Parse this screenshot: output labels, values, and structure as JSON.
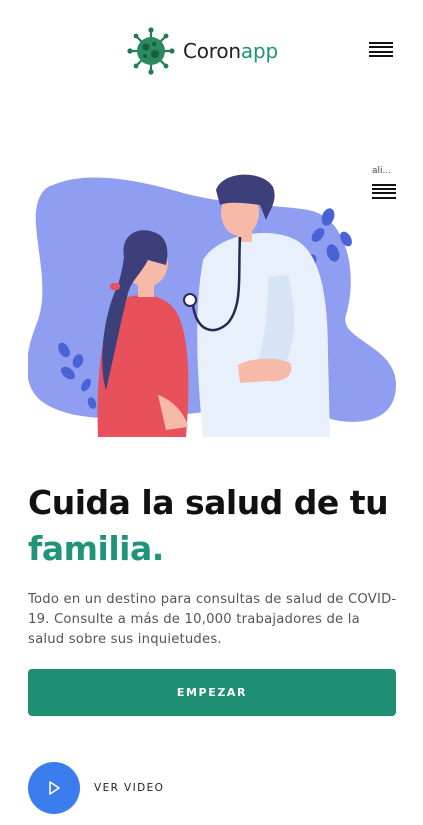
{
  "header": {
    "logo_part1": "Coron",
    "logo_part2": "app",
    "menu_icon": "hamburger-menu-icon",
    "logo_icon": "virus-icon"
  },
  "side_menu": {
    "label": "ali...",
    "icon": "hamburger-menu-icon"
  },
  "hero": {
    "illustration": "doctor-examining-girl-illustration",
    "headline_line1": "Cuida la salud de tu",
    "headline_line2": "familia.",
    "description": "Todo en un destino para consultas de salud de COVID-19. Consulte a más de 10,000 trabajadores de la salud sobre sus inquietudes.",
    "cta_label": "EMPEZAR",
    "video_label": "VER VIDEO",
    "video_icon": "play-icon"
  },
  "colors": {
    "accent": "#1f9479",
    "button": "#1f8f74",
    "play_button": "#3b7ded",
    "blob": "#8f9ef0"
  }
}
